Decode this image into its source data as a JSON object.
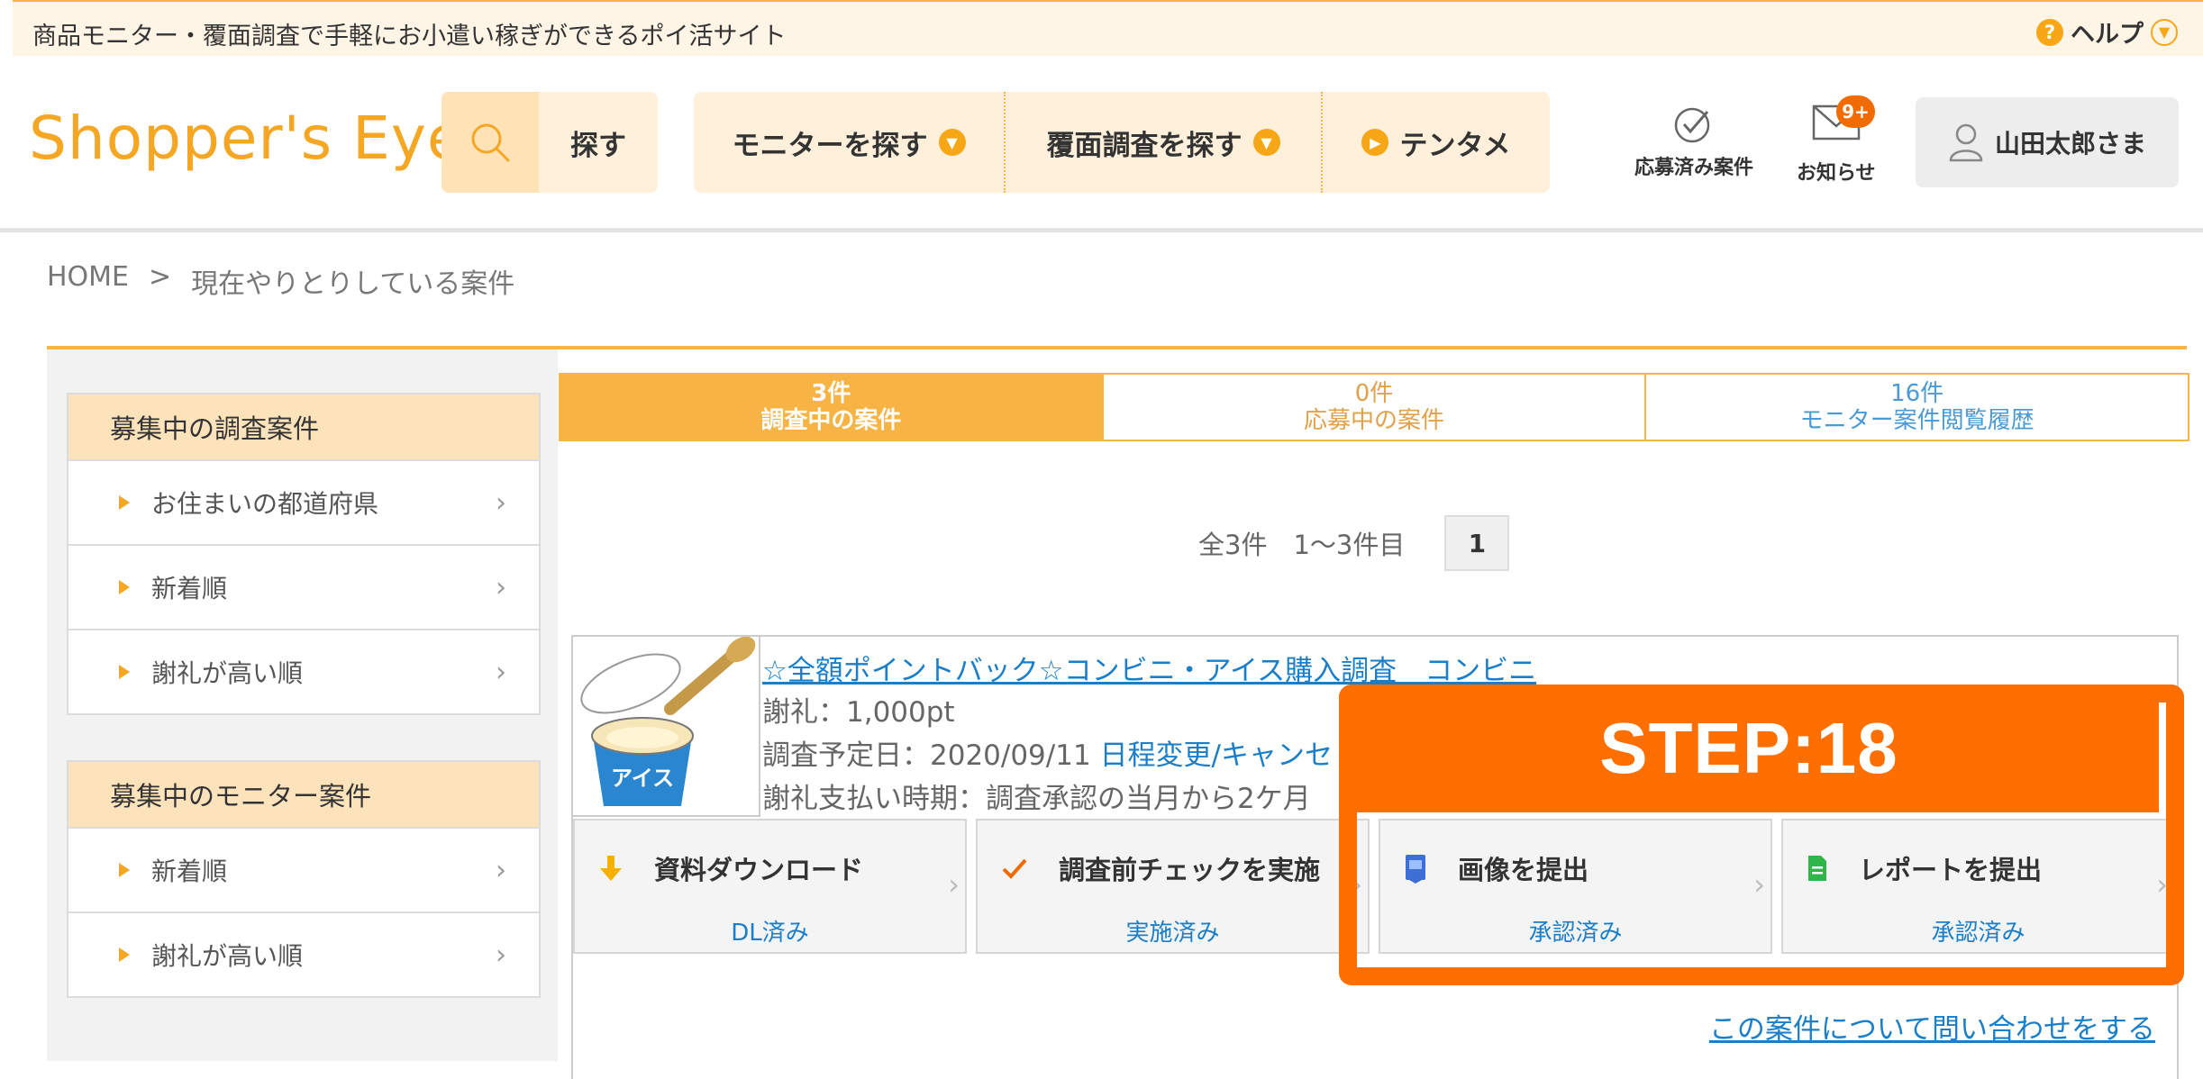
{
  "topbar": {
    "tagline": "商品モニター・覆面調査で手軽にお小遣い稼ぎができるポイ活サイト",
    "help_label": "ヘルプ"
  },
  "header": {
    "logo": "Shopper's Eye",
    "search_label": "探す",
    "nav": [
      {
        "label": "モニターを探す"
      },
      {
        "label": "覆面調査を探す"
      },
      {
        "label": "テンタメ"
      }
    ],
    "applied_label": "応募済み案件",
    "notice_label": "お知らせ",
    "notice_badge": "9+",
    "user_label": "山田太郎さま"
  },
  "breadcrumb": {
    "home": "HOME",
    "sep": ">",
    "current": "現在やりとりしている案件"
  },
  "sidebar": {
    "survey_box": {
      "title": "募集中の調査案件",
      "items": [
        "お住まいの都道府県",
        "新着順",
        "謝礼が高い順"
      ]
    },
    "monitor_box": {
      "title": "募集中のモニター案件",
      "items": [
        "新着順",
        "謝礼が高い順"
      ]
    }
  },
  "tabs": [
    {
      "count": "3件",
      "label": "調査中の案件"
    },
    {
      "count": "0件",
      "label": "応募中の案件"
    },
    {
      "count": "16件",
      "label": "モニター案件閲覧履歴"
    }
  ],
  "pagination": {
    "summary": "全3件　1〜3件目",
    "page": "1"
  },
  "case": {
    "title": "☆全額ポイントバック☆コンビニ・アイス購入調査　コンビニ",
    "reward": "謝礼：1,000pt",
    "schedule_prefix": "調査予定日：2020/09/11 ",
    "schedule_link": "日程変更/キャンセ",
    "payment": "謝礼支払い時期：調査承認の当月から2ケ月",
    "steps": [
      {
        "title": "資料ダウンロード",
        "status": "DL済み",
        "icon": "download-arrow-icon"
      },
      {
        "title": "調査前チェックを実施",
        "status": "実施済み",
        "icon": "check-icon"
      },
      {
        "title": "画像を提出",
        "status": "承認済み",
        "icon": "image-doc-icon"
      },
      {
        "title": "レポートを提出",
        "status": "承認済み",
        "icon": "report-doc-icon"
      }
    ],
    "contact_link": "この案件について問い合わせをする"
  },
  "overlay": {
    "step_label": "STEP:18"
  },
  "colors": {
    "accent": "#f5a623",
    "highlight": "#ff6f00",
    "link": "#1a7ec8"
  }
}
